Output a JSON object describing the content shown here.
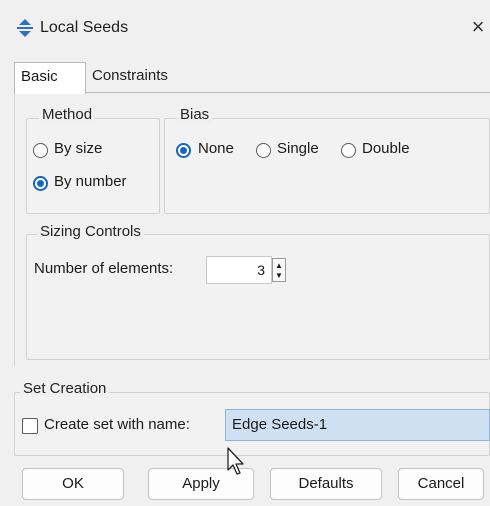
{
  "window": {
    "title": "Local Seeds",
    "close_glyph": "×",
    "icon": "seed-arrows-icon"
  },
  "tabs": [
    {
      "label": "Basic",
      "active": true
    },
    {
      "label": "Constraints",
      "active": false
    }
  ],
  "method": {
    "legend": "Method",
    "options": [
      {
        "label": "By size",
        "selected": false
      },
      {
        "label": "By number",
        "selected": true
      }
    ]
  },
  "bias": {
    "legend": "Bias",
    "options": [
      {
        "label": "None",
        "selected": true
      },
      {
        "label": "Single",
        "selected": false
      },
      {
        "label": "Double",
        "selected": false
      }
    ]
  },
  "sizing": {
    "legend": "Sizing Controls",
    "number_label": "Number of elements:",
    "number_value": "3",
    "spin_up": "▲",
    "spin_down": "▼"
  },
  "set_creation": {
    "legend": "Set Creation",
    "checkbox_label": "Create set with name:",
    "checked": false,
    "name_value": "Edge Seeds-1"
  },
  "buttons": {
    "ok": "OK",
    "apply": "Apply",
    "defaults": "Defaults",
    "cancel": "Cancel"
  },
  "colors": {
    "accent": "#1565c0",
    "selection_bg": "#cfe0f2"
  }
}
